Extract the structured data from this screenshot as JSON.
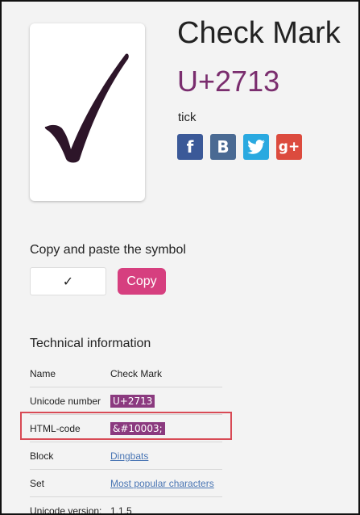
{
  "glyph": {
    "symbol": "✓",
    "name": "check-mark"
  },
  "header": {
    "title": "Check Mark",
    "code": "U+2713",
    "alias": "tick"
  },
  "social": [
    {
      "name": "facebook-icon",
      "glyph": "f",
      "color": "#3b5998"
    },
    {
      "name": "vk-icon",
      "glyph": "B",
      "color": "#4a6a93"
    },
    {
      "name": "twitter-icon",
      "glyph": "t",
      "color": "#2aa9e0"
    },
    {
      "name": "google-plus-icon",
      "glyph": "g+",
      "color": "#dc4b3e"
    }
  ],
  "copy": {
    "heading": "Copy and paste the symbol",
    "input_value": "✓",
    "button_label": "Copy",
    "button_color": "#d63f7f"
  },
  "tech": {
    "heading": "Technical information",
    "rows": [
      {
        "label": "Name",
        "value": "Check Mark",
        "style": "text"
      },
      {
        "label": "Unicode number",
        "value": "U+2713",
        "style": "tag"
      },
      {
        "label": "HTML-code",
        "value": "&#10003;",
        "style": "tag"
      },
      {
        "label": "Block",
        "value": "Dingbats",
        "style": "link"
      },
      {
        "label": "Set",
        "value": "Most popular characters",
        "style": "link"
      },
      {
        "label": "Unicode version:",
        "value": "1.1.5",
        "style": "text"
      }
    ]
  },
  "colors": {
    "accent": "#7a2d6e",
    "tag_bg": "#8b3a7f",
    "link": "#4a76b4",
    "highlight": "#d84a55"
  }
}
